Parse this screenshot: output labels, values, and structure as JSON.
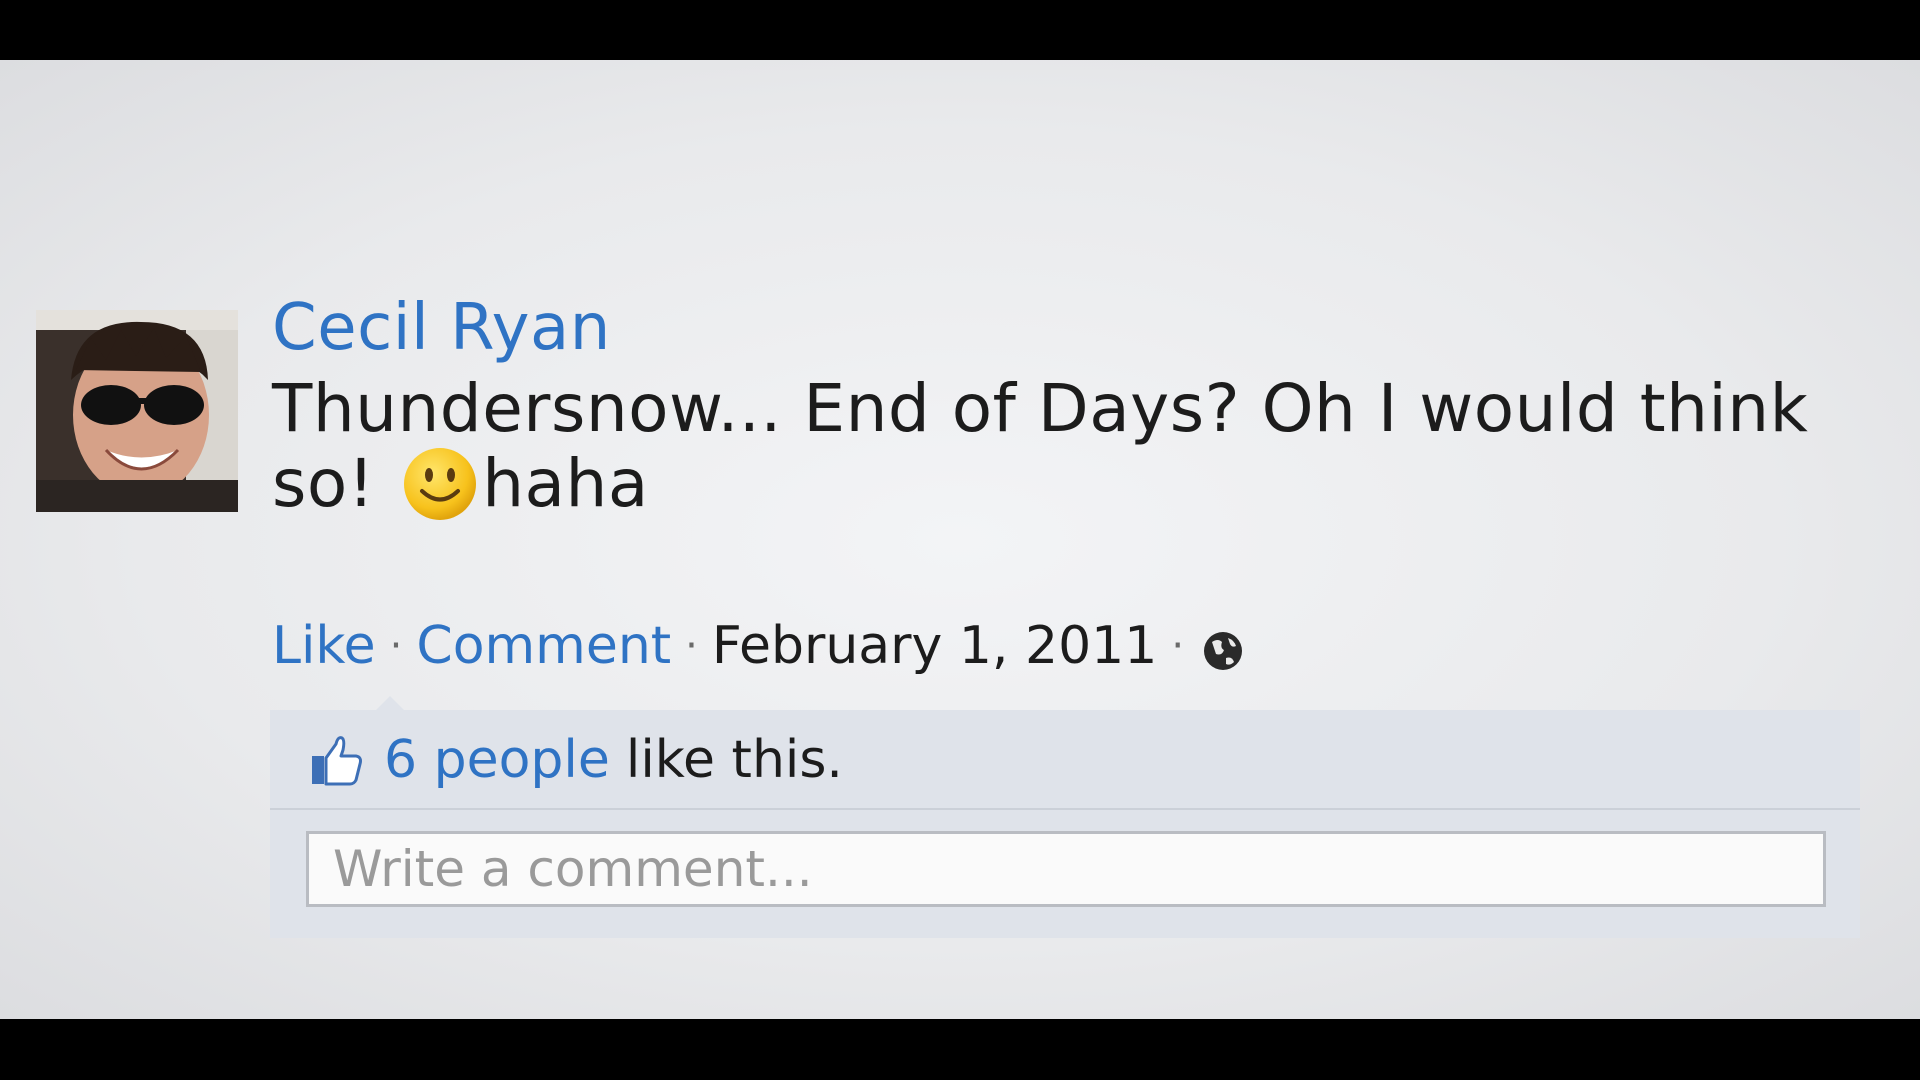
{
  "post": {
    "author": "Cecil Ryan",
    "text_main": "Thundersnow... End of Days? Oh I would think so!",
    "emoji": "smiley-emoji",
    "text_tail": "haha"
  },
  "actions": {
    "like_label": "Like",
    "comment_label": "Comment",
    "separator": "·",
    "date": "February 1, 2011",
    "privacy_icon": "globe-icon"
  },
  "likes": {
    "icon": "thumbs-up-icon",
    "count_text": "6 people",
    "suffix": "like this."
  },
  "comment_box": {
    "placeholder": "Write a comment..."
  },
  "colors": {
    "link": "#2f73c4",
    "text": "#1c1c1c",
    "interaction_bg": "#dfe3ea"
  }
}
